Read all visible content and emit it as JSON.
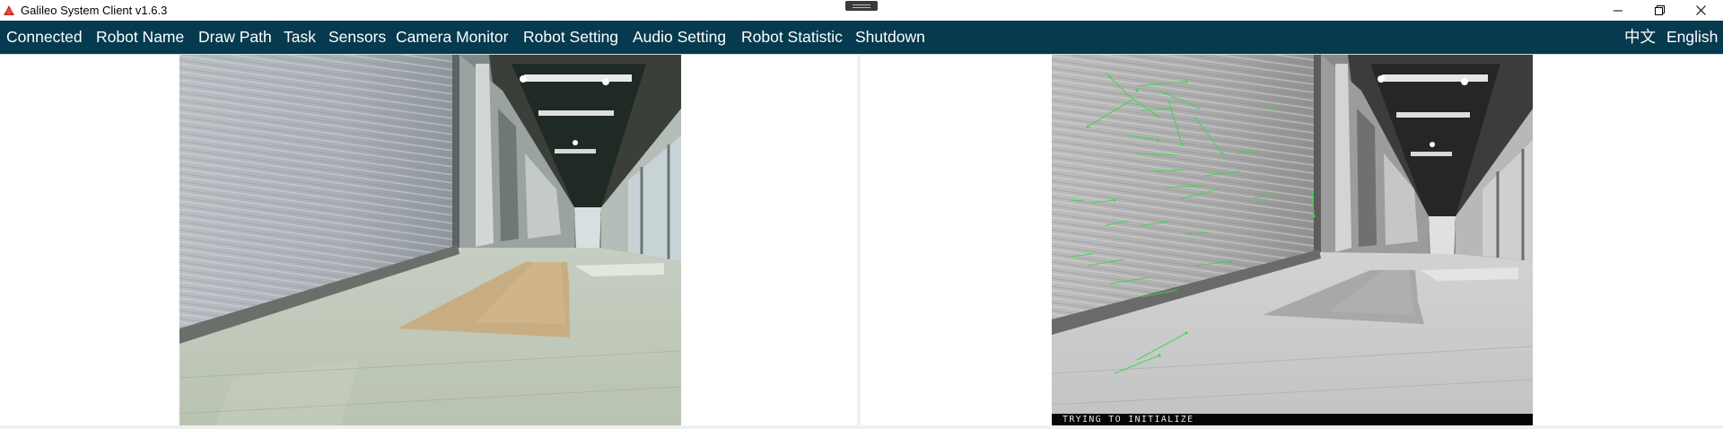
{
  "window": {
    "title": "Galileo System Client v1.6.3",
    "icon": "galileo-app-icon",
    "controls": [
      "minimize-icon",
      "maximize-icon",
      "close-icon"
    ]
  },
  "menu": {
    "items": [
      {
        "label": "Connected"
      },
      {
        "label": "Robot Name"
      },
      {
        "label": "Draw Path"
      },
      {
        "label": "Task"
      },
      {
        "label": "Sensors"
      },
      {
        "label": "Camera Monitor"
      },
      {
        "label": "Robot Setting"
      },
      {
        "label": "Audio Setting"
      },
      {
        "label": "Robot Statistic"
      },
      {
        "label": "Shutdown"
      }
    ],
    "languages": [
      {
        "label": "中文"
      },
      {
        "label": "English"
      }
    ]
  },
  "cameras": {
    "left": {
      "name": "color-camera-feed"
    },
    "right": {
      "name": "tracking-camera-feed",
      "status": "TRYING TO INITIALIZE",
      "overlay_color": "#39d84a"
    }
  },
  "colors": {
    "menubar": "#053a4f",
    "menu_text": "#ffffff",
    "icon_red": "#c0262d"
  }
}
